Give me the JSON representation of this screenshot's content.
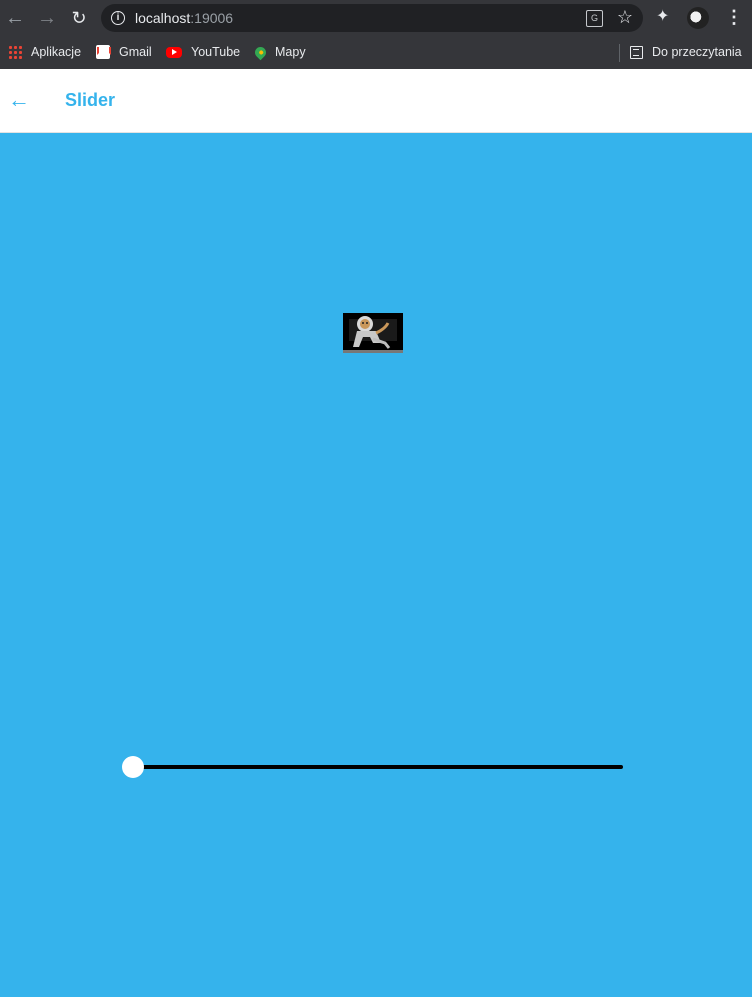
{
  "browser": {
    "url_host": "localhost",
    "url_port": ":19006",
    "bookmarks": [
      {
        "label": "Aplikacje",
        "icon": "apps-grid-icon"
      },
      {
        "label": "Gmail",
        "icon": "gmail-icon"
      },
      {
        "label": "YouTube",
        "icon": "youtube-icon"
      },
      {
        "label": "Mapy",
        "icon": "maps-icon"
      }
    ],
    "reading_list_label": "Do przeczytania"
  },
  "appbar": {
    "title": "Slider",
    "accent_color": "#35b3ec"
  },
  "content": {
    "background_color": "#35b3ec",
    "image_alt_icon": "astronaut-monkey-image"
  },
  "slider": {
    "value": 0,
    "track_color": "#000000",
    "thumb_color": "#ffffff"
  }
}
